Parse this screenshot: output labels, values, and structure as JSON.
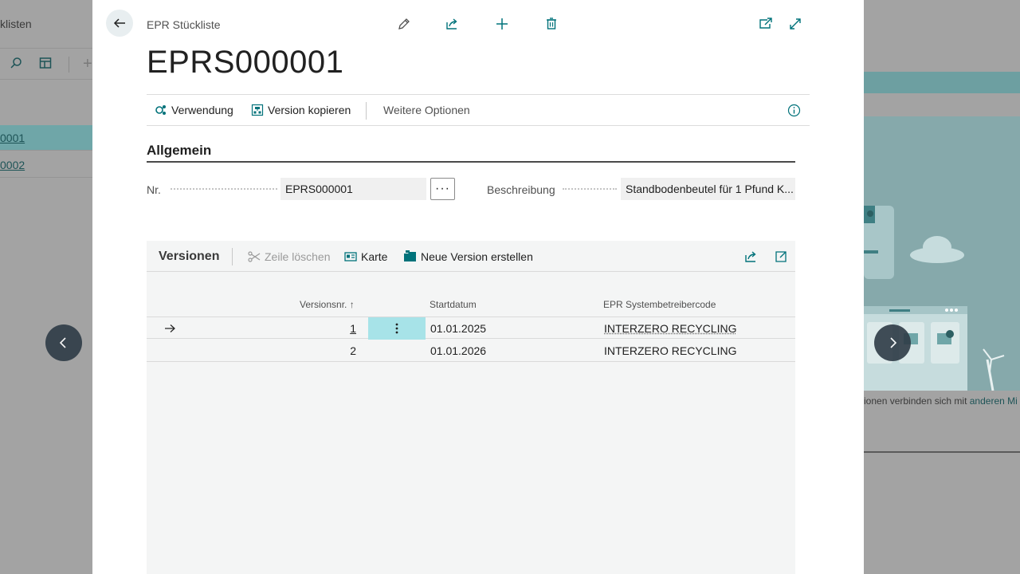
{
  "background": {
    "left_title_fragment": "klisten",
    "left_rows": [
      "0001",
      "0002"
    ],
    "caption_text": "ionen verbinden sich mit ",
    "caption_link": "anderen Mi"
  },
  "dialog": {
    "breadcrumb": "EPR Stückliste",
    "title": "EPRS000001",
    "actions": {
      "verwendung": "Verwendung",
      "version_kopieren": "Version kopieren",
      "weitere_optionen": "Weitere Optionen"
    },
    "section_title": "Allgemein",
    "fields": {
      "nr_label": "Nr.",
      "nr_value": "EPRS000001",
      "beschreibung_label": "Beschreibung",
      "beschreibung_value": "Standbodenbeutel für 1 Pfund K..."
    },
    "subpage": {
      "title": "Versionen",
      "actions": {
        "zeile_loeschen": "Zeile löschen",
        "karte": "Karte",
        "neue_version": "Neue Version erstellen"
      },
      "columns": {
        "versionsnr": "Versionsnr. ↑",
        "startdatum": "Startdatum",
        "systembetreiber": "EPR Systembetreibercode"
      },
      "rows": [
        {
          "versionsnr": "1",
          "startdatum": "01.01.2025",
          "code": "INTERZERO RECYCLING"
        },
        {
          "versionsnr": "2",
          "startdatum": "01.01.2026",
          "code": "INTERZERO RECYCLING"
        }
      ]
    }
  },
  "colors": {
    "accent": "#00727a",
    "row_selected": "#a7e3e8",
    "nav_button": "#2e3b46"
  }
}
